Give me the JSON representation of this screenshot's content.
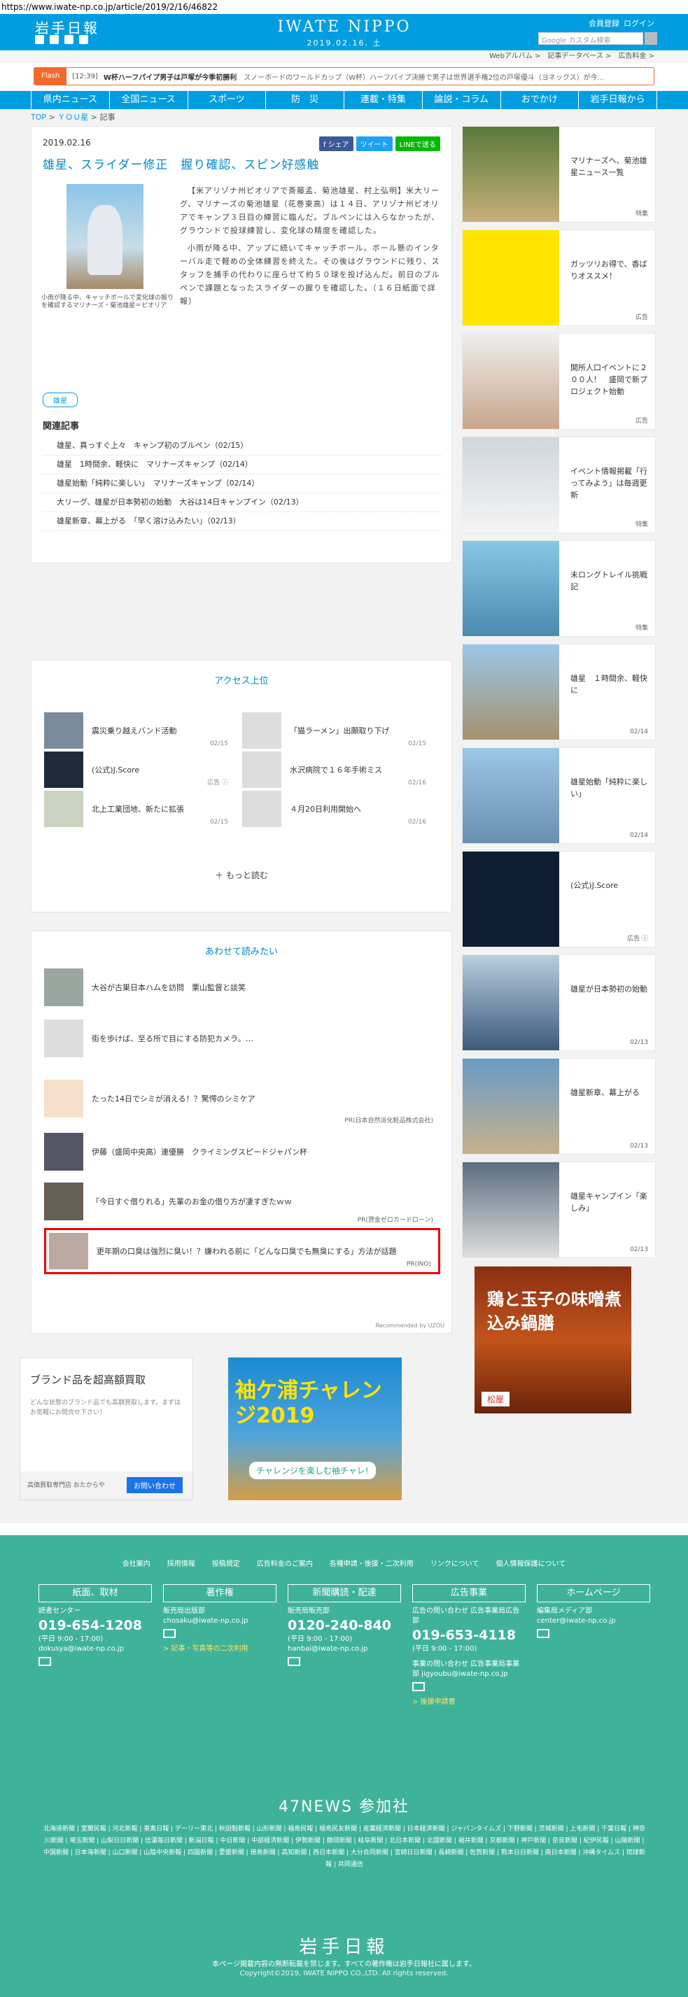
{
  "url": "https://www.iwate-np.co.jp/article/2019/2/16/46822",
  "header": {
    "logo_left": "岩手日報",
    "logo_center": "IWATE NIPPO",
    "date": "2019.02.16. 土",
    "link_register": "会員登録",
    "link_login": "ログイン",
    "search_placeholder": "Google カスタム検索"
  },
  "sublinks": [
    "Webアルバム >",
    "記事データベース >",
    "広告料金 >"
  ],
  "flash": {
    "label": "Flash",
    "time": "[12:39]",
    "bold": "W杯ハーフパイプ男子は戸塚が今季初勝利",
    "rest": "スノーボードのワールドカップ（W杯）ハーフパイプ決勝で男子は世界選手権2位の戸塚優斗（ヨネックス）が今..."
  },
  "nav": [
    "県内ニュース",
    "全国ニュース",
    "スポーツ",
    "防　災",
    "連載・特集",
    "論説・コラム",
    "おでかけ",
    "岩手日報から"
  ],
  "breadcrumb": {
    "top": "TOP",
    "sep1": " > ",
    "you": "ＹＯＵ星",
    "sep2": " > ",
    "cur": "記事"
  },
  "article": {
    "date": "2019.02.16",
    "share_fb": "f シェア",
    "share_tw": "ツイート",
    "share_ln": "LINEで送る",
    "title": "雄星、スライダー修正　握り確認、スピン好感触",
    "caption": "小雨が降る中、キャッチボールで変化球の握りを確認するマリナーズ・菊池雄星＝ピオリア",
    "p1": "【米アリゾナ州ピオリアで斎藤孟、菊池雄星、村上弘明】米大リーグ、マリナーズの菊池雄星（花巻東高）は１４日、アリゾナ州ピオリアでキャンプ３日目の練習に臨んだ。ブルペンには入らなかったが、グラウンドで投球練習し、変化球の精度を確認した。",
    "p2": "小雨が降る中、アップに続いてキャッチボール。ボール懸のインターバル走で軽めの全体練習を終えた。その後はグラウンドに残り、スタッフを捕手の代わりに座らせて約５０球を投げ込んだ。前日のブルペンで課題となったスライダーの握りを確認した。（１６日紙面で詳報）",
    "tag": "雄星",
    "related_heading": "関連記事",
    "related": [
      "雄星、真っすぐ上々　キャンプ初のブルペン（02/15）",
      "雄星　1時間余、軽快に　マリナーズキャンプ（02/14）",
      "雄星始動「純粋に楽しい」　マリナーズキャンプ（02/14）",
      "大リーグ、雄星が日本勢初の始動　大谷は14日キャンプイン（02/13）",
      "雄星新章、幕上がる　「早く溶け込みたい」（02/13）"
    ]
  },
  "access": {
    "heading": "アクセス上位",
    "items": [
      {
        "text": "震災乗り越えバンド活動",
        "date": "02/15"
      },
      {
        "text": "「猫ラーメン」出願取り下げ",
        "date": "02/15"
      },
      {
        "text": "(公式)J.Score",
        "date": "広告 ⓘ"
      },
      {
        "text": "水沢病院で１６年手術ミス",
        "date": "02/16"
      },
      {
        "text": "北上工業団地、新たに拡張",
        "date": "02/15"
      },
      {
        "text": "４月20日利用開始へ",
        "date": "02/16"
      }
    ],
    "more": "もっと読む"
  },
  "together": {
    "heading": "あわせて読みたい",
    "items": [
      {
        "text": "大谷が古巣日本ハムを訪問　栗山監督と談笑",
        "pr": ""
      },
      {
        "text": "街を歩けば、至る所で目にする防犯カメラ。…",
        "pr": ""
      },
      {
        "text": "たった14日でシミが消える！？驚愕のシミケア",
        "pr": "PR(日本自然派化粧品株式会社)"
      },
      {
        "text": "伊藤（盛岡中央高）連優勝　クライミングスピードジャパン杯",
        "pr": ""
      },
      {
        "text": "「今日すぐ借りれる」先輩のお金の借り方が凄すぎたｗｗ",
        "pr": "PR(貸金ゼロカードローン)"
      },
      {
        "text": "更年期の口臭は強烈に臭い！？嫌われる前に「どんな口臭でも無臭にする」方法が話題",
        "pr": "PR(INO)"
      }
    ],
    "recommend": "Recommended by UZOU"
  },
  "ad1": {
    "title": "ブランド品を超高額買取",
    "desc": "どんな状態のブランド品でも高額買取します。まずはお気軽にお問合せ下さい！",
    "foot": "高価買取専門店 おたからや",
    "btn": "お問い合わせ"
  },
  "ad2": {
    "title": "袖ケ浦チャレンジ2019",
    "btn": "チャレンジを楽しむ袖チャレ!"
  },
  "right": [
    {
      "text": "マリナーズへ、菊池雄星ニュース一覧",
      "date": "特集"
    },
    {
      "text": "ガッツリお得で、香ばりオススメ！",
      "date": "広告"
    },
    {
      "text": "開所人口イベントに２００人！　盛岡で新プロジェクト始動",
      "date": "広告"
    },
    {
      "text": "イベント情報掲載「行ってみよう」は毎週更新",
      "date": "特集"
    },
    {
      "text": "未ロングトレイル挑戦記",
      "date": "特集"
    },
    {
      "text": "雄星　１時間余、軽快に",
      "date": "02/14"
    },
    {
      "text": "雄星始動「純粋に楽しい」",
      "date": "02/14"
    },
    {
      "text": "(公式)J.Score",
      "date": "広告 ⓘ"
    },
    {
      "text": "雄星が日本勢初の始動",
      "date": "02/13"
    },
    {
      "text": "雄星新章、幕上がる",
      "date": "02/13"
    },
    {
      "text": "雄星キャンプイン「楽しみ」",
      "date": "02/13"
    }
  ],
  "right_ad": {
    "title": "鶏と玉子の味噌煮込み鍋膳",
    "brand": "松屋"
  },
  "footer": {
    "links": [
      "会社案内",
      "採用情報",
      "投稿規定",
      "広告料金のご案内",
      "各種申請・後援・二次利用",
      "リンクについて",
      "個人情報保護について"
    ],
    "cols": [
      {
        "head": "紙面、取材",
        "l1": "読者センター",
        "big": "019-654-1208",
        "l2": "(平日 9:00 - 17:00)",
        "l3": "dokusya@iwate-np.co.jp",
        "l4": ""
      },
      {
        "head": "著作権",
        "l1": "販売局出版部",
        "big": "",
        "l2": "chosaku@iwate-np.co.jp",
        "l3": "",
        "l4": "> 記事・写真等の二次利用"
      },
      {
        "head": "新聞購読・配達",
        "l1": "販売局販売部",
        "big": "0120-240-840",
        "l2": "(平日 9:00 - 17:00)",
        "l3": "hanbai@iwate-np.co.jp",
        "l4": ""
      },
      {
        "head": "広告事業",
        "l1": "広告の問い合わせ 広告事業局広告部",
        "big": "019-653-4118",
        "l2": "(平日 9:00 - 17:00)",
        "l3": "事業の問い合わせ 広告事業局事業部 jigyoubu@iwate-np.co.jp",
        "l4": "> 後援申請書"
      },
      {
        "head": "ホームページ",
        "l1": "編集局メディア部",
        "big": "",
        "l2": "center@iwate-np.co.jp",
        "l3": "",
        "l4": ""
      }
    ],
    "n47": "47NEWS 参加社",
    "papers": "北海道新聞 | 室蘭民報 | 河北新報 | 東奥日報 | デーリー東北 | 秋田魁新報 | 山形新聞 | 福島民報 | 福島民友新聞 | 産業経済新聞 | 日本経済新聞 | ジャパンタイムズ | 下野新聞 | 茨城新聞 | 上毛新聞 | 千葉日報 | 神奈川新聞 | 埼玉新聞 | 山梨日日新聞 | 信濃毎日新聞 | 新潟日報 | 中日新聞 | 中部経済新聞 | 伊勢新聞 | 静岡新聞 | 岐阜新聞 | 北日本新聞 | 北國新聞 | 福井新聞 | 京都新聞 | 神戸新聞 | 奈良新聞 | 紀伊民報 | 山陽新聞 | 中国新聞 | 日本海新聞 | 山口新聞 | 山陰中央新報 | 四国新聞 | 愛媛新聞 | 徳島新聞 | 高知新聞 | 西日本新聞 | 大分合同新聞 | 宮崎日日新聞 | 長崎新聞 | 佐賀新聞 | 熊本日日新聞 | 南日本新聞 | 沖縄タイムス | 琉球新報 | 共同通信",
    "brand": "岩手日報",
    "copy1": "本ページ掲載内容の無断転載を禁じます。すべての著作権は岩手日報社に属します。",
    "copy2": "Copyright©2019, IWATE NIPPO CO.,LTD. All rights reserved."
  }
}
